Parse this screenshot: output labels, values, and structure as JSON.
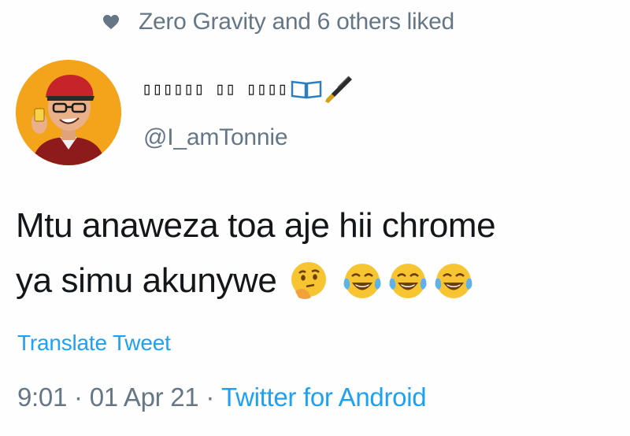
{
  "social_context": {
    "icon": "heart-icon",
    "text": "Zero Gravity and 6 others liked"
  },
  "author": {
    "avatar": "avatar",
    "display_name_boxes": "▯▯▯▯▯▯ ▯▯ ▯▯▯▯",
    "display_name_emojis": [
      "open-book-icon",
      "fountain-pen-icon"
    ],
    "handle": "@I_amTonnie"
  },
  "tweet": {
    "line1": "Mtu anaweza toa aje hii chrome",
    "line2": "ya simu akunywe",
    "emojis": [
      "thinking-face-icon",
      "tears-of-joy-icon",
      "tears-of-joy-icon",
      "tears-of-joy-icon"
    ]
  },
  "translate_label": "Translate Tweet",
  "meta": {
    "time": "9:01",
    "separator": "·",
    "date": "01 Apr 21",
    "source": "Twitter for Android"
  },
  "colors": {
    "text_primary": "#14171a",
    "text_secondary": "#657786",
    "link": "#1da1f2",
    "avatar_bg": "#f4a41b"
  }
}
